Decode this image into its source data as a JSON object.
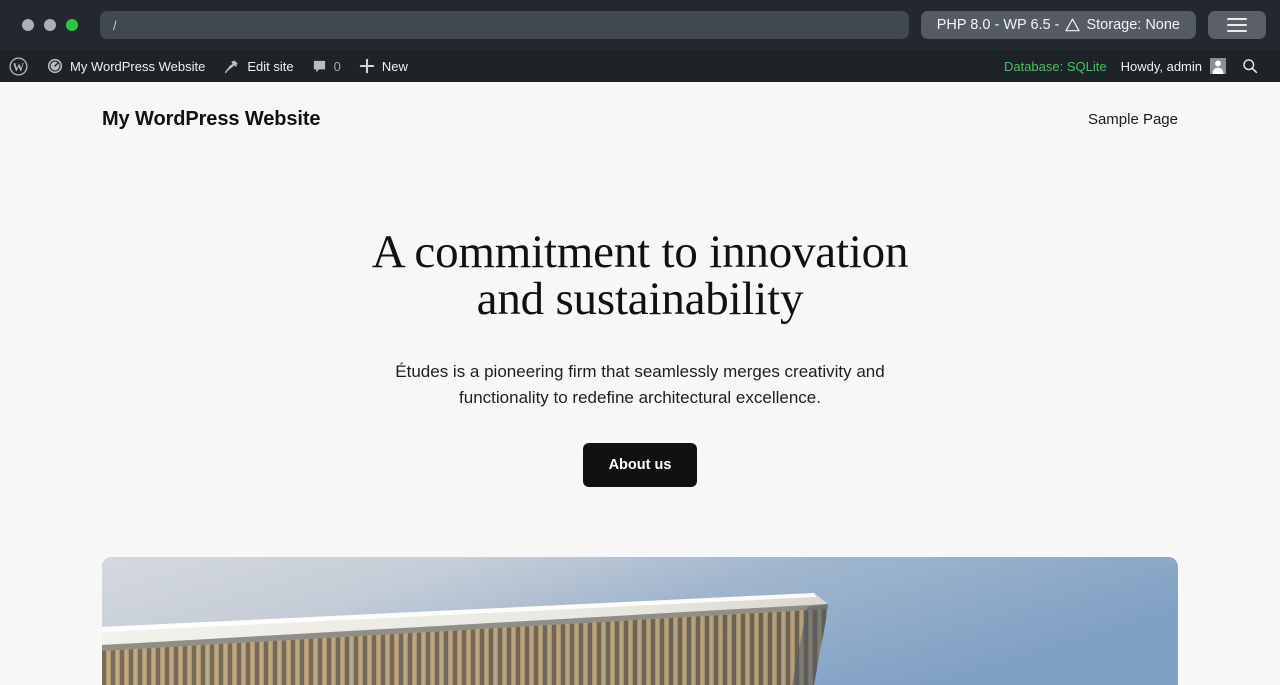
{
  "browser": {
    "url_value": "/",
    "url_placeholder": "/",
    "status_php": "PHP 8.0 - WP 6.5 -",
    "status_warning_icon": "warning-triangle-icon",
    "status_storage": "Storage: None",
    "menu_icon": "hamburger-menu-icon",
    "traffic_lights": [
      "close-dot",
      "minimize-dot",
      "maximize-dot"
    ],
    "colors": {
      "chrome_bg": "#23272e",
      "url_bg": "#414852",
      "pill_bg": "#555b63",
      "menu_bg": "#5c6066",
      "dot_gray": "#a9b0b8",
      "dot_green": "#2bc740"
    }
  },
  "admin_bar": {
    "wp_logo_icon": "wordpress-logo-icon",
    "items": [
      {
        "icon": "dashboard-gauge-icon",
        "label": "My WordPress Website"
      },
      {
        "icon": "pin-icon",
        "label": "Edit site"
      },
      {
        "icon": "comment-bubble-icon",
        "label": "0"
      },
      {
        "icon": "plus-icon",
        "label": "New"
      }
    ],
    "database_label": "Database: SQLite",
    "database_color": "#46c266",
    "howdy_label": "Howdy, admin",
    "avatar_icon": "user-avatar-icon",
    "search_icon": "search-icon",
    "bg_color": "#1d2327"
  },
  "site": {
    "title": "My WordPress Website",
    "nav": [
      {
        "label": "Sample Page"
      }
    ],
    "hero": {
      "heading_line1": "A commitment to innovation",
      "heading_line2": "and sustainability",
      "subtitle": "Études is a pioneering firm that seamlessly merges creativity and functionality to redefine architectural excellence.",
      "cta_label": "About us",
      "cta_bg": "#111111",
      "image_alt": "modern-building-slatted-facade-against-sky"
    },
    "bg_color": "#f7f7f7"
  }
}
